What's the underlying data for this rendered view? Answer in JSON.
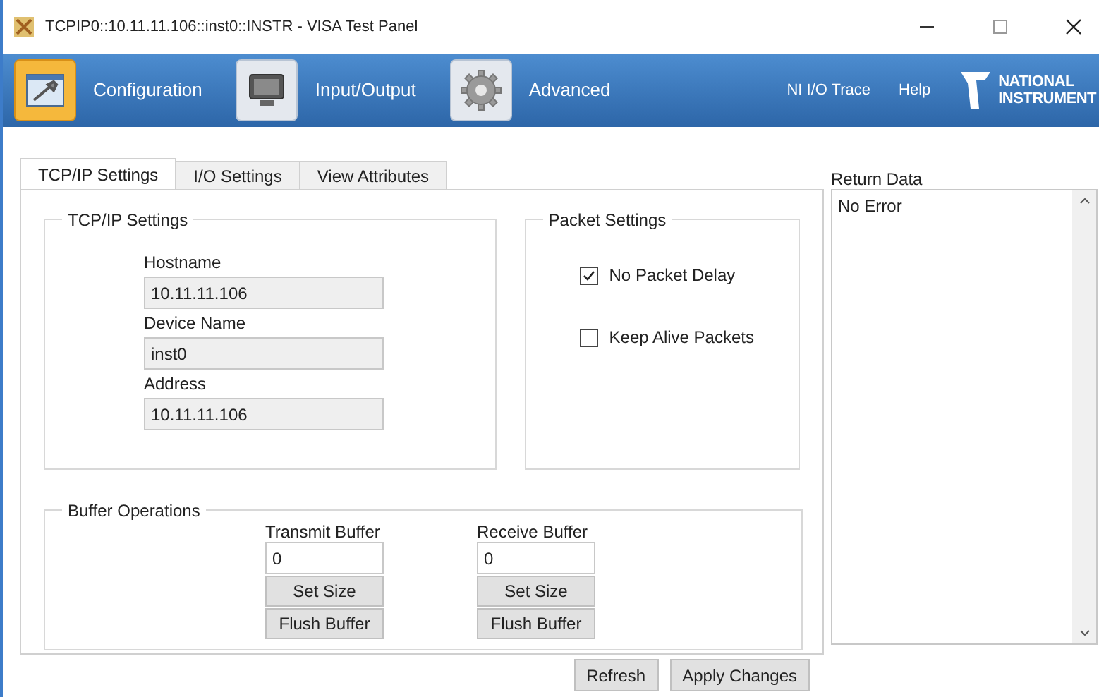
{
  "window": {
    "title": "TCPIP0::10.11.11.106::inst0::INSTR - VISA Test Panel"
  },
  "toolbar": {
    "items": [
      {
        "label": "Configuration",
        "kind": "config",
        "selected": true
      },
      {
        "label": "Input/Output",
        "kind": "monitor",
        "selected": false
      },
      {
        "label": "Advanced",
        "kind": "gear",
        "selected": false
      }
    ],
    "links": [
      "NI I/O Trace",
      "Help"
    ],
    "logo": {
      "line_1": "NATIONAL",
      "line_2": "INSTRUMENT"
    }
  },
  "tabs": [
    {
      "label": "TCP/IP Settings",
      "selected": true
    },
    {
      "label": "I/O Settings",
      "selected": false
    },
    {
      "label": "View Attributes",
      "selected": false
    }
  ],
  "tcpip_settings": {
    "title": "TCP/IP Settings",
    "fields": [
      {
        "label": "Hostname",
        "value": "10.11.11.106"
      },
      {
        "label": "Device Name",
        "value": "inst0"
      },
      {
        "label": "Address",
        "value": "10.11.11.106"
      }
    ]
  },
  "packet_settings": {
    "title": "Packet Settings",
    "options": [
      {
        "label": "No Packet Delay",
        "checked": true
      },
      {
        "label": "Keep Alive Packets",
        "checked": false
      }
    ]
  },
  "buffer_operations": {
    "title": "Buffer Operations",
    "buffers": [
      {
        "label": "Transmit Buffer",
        "value": "0",
        "buttons": [
          "Set Size",
          "Flush Buffer"
        ]
      },
      {
        "label": "Receive Buffer",
        "value": "0",
        "buttons": [
          "Set Size",
          "Flush Buffer"
        ]
      }
    ]
  },
  "return_data": {
    "label": "Return Data",
    "text": "No Error"
  },
  "buttons": [
    "Refresh",
    "Apply Changes"
  ]
}
